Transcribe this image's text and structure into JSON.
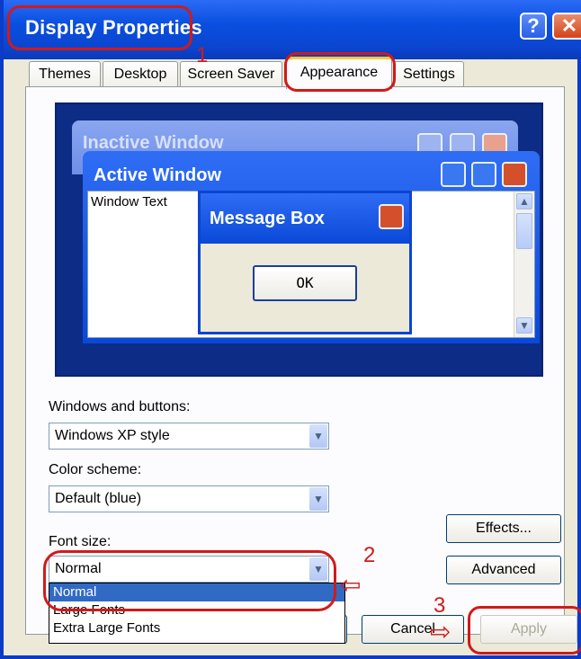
{
  "window": {
    "title": "Display Properties",
    "help_glyph": "?",
    "close_glyph": "✕"
  },
  "tabs": [
    {
      "label": "Themes",
      "active": false
    },
    {
      "label": "Desktop",
      "active": false
    },
    {
      "label": "Screen Saver",
      "active": false
    },
    {
      "label": "Appearance",
      "active": true
    },
    {
      "label": "Settings",
      "active": false
    }
  ],
  "preview": {
    "inactive_title": "Inactive Window",
    "active_title": "Active Window",
    "window_text": "Window Text",
    "message_title": "Message Box",
    "ok_label": "OK"
  },
  "form": {
    "windows_buttons_label": "Windows and buttons:",
    "windows_buttons_value": "Windows XP style",
    "color_scheme_label": "Color scheme:",
    "color_scheme_value": "Default (blue)",
    "font_size_label": "Font size:",
    "font_size_value": "Normal",
    "font_size_options": [
      "Normal",
      "Large Fonts",
      "Extra Large Fonts"
    ]
  },
  "buttons": {
    "effects": "Effects...",
    "advanced": "Advanced",
    "cancel": "Cancel",
    "apply": "Apply"
  },
  "annotations": {
    "step1": "1",
    "step2": "2",
    "step3": "3"
  },
  "colors": {
    "title_blue": "#0b45d0",
    "annotation_red": "#d11a1a",
    "selection": "#316ac5"
  }
}
